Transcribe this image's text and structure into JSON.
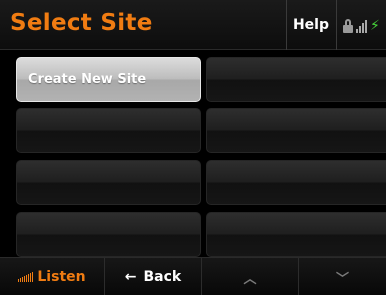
{
  "header": {
    "title": "Select Site",
    "help_label": "Help",
    "status_icons": [
      "lock-icon",
      "signal-bars-icon",
      "charging-bolt-icon"
    ],
    "title_color": "#f07c12",
    "charging_color": "#47d63a"
  },
  "tiles": [
    {
      "label": "Create New Site",
      "selected": true
    },
    {
      "label": "",
      "selected": false
    },
    {
      "label": "",
      "selected": false
    },
    {
      "label": "",
      "selected": false
    },
    {
      "label": "",
      "selected": false
    },
    {
      "label": "",
      "selected": false
    },
    {
      "label": "",
      "selected": false
    },
    {
      "label": "",
      "selected": false
    }
  ],
  "footer": {
    "listen_label": "Listen",
    "back_label": "Back",
    "back_icon": "left-arrow-icon",
    "up_icon": "chevron-up-icon",
    "down_icon": "chevron-down-icon",
    "accent_color": "#f07c12"
  }
}
